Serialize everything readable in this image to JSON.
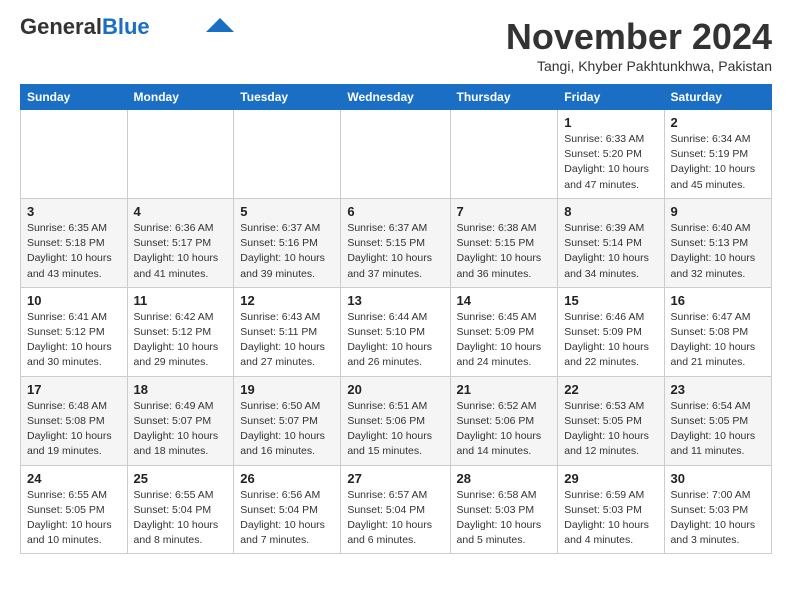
{
  "header": {
    "logo_general": "General",
    "logo_blue": "Blue",
    "month_title": "November 2024",
    "location": "Tangi, Khyber Pakhtunkhwa, Pakistan"
  },
  "days_of_week": [
    "Sunday",
    "Monday",
    "Tuesday",
    "Wednesday",
    "Thursday",
    "Friday",
    "Saturday"
  ],
  "weeks": [
    [
      {
        "day": "",
        "info": ""
      },
      {
        "day": "",
        "info": ""
      },
      {
        "day": "",
        "info": ""
      },
      {
        "day": "",
        "info": ""
      },
      {
        "day": "",
        "info": ""
      },
      {
        "day": "1",
        "info": "Sunrise: 6:33 AM\nSunset: 5:20 PM\nDaylight: 10 hours\nand 47 minutes."
      },
      {
        "day": "2",
        "info": "Sunrise: 6:34 AM\nSunset: 5:19 PM\nDaylight: 10 hours\nand 45 minutes."
      }
    ],
    [
      {
        "day": "3",
        "info": "Sunrise: 6:35 AM\nSunset: 5:18 PM\nDaylight: 10 hours\nand 43 minutes."
      },
      {
        "day": "4",
        "info": "Sunrise: 6:36 AM\nSunset: 5:17 PM\nDaylight: 10 hours\nand 41 minutes."
      },
      {
        "day": "5",
        "info": "Sunrise: 6:37 AM\nSunset: 5:16 PM\nDaylight: 10 hours\nand 39 minutes."
      },
      {
        "day": "6",
        "info": "Sunrise: 6:37 AM\nSunset: 5:15 PM\nDaylight: 10 hours\nand 37 minutes."
      },
      {
        "day": "7",
        "info": "Sunrise: 6:38 AM\nSunset: 5:15 PM\nDaylight: 10 hours\nand 36 minutes."
      },
      {
        "day": "8",
        "info": "Sunrise: 6:39 AM\nSunset: 5:14 PM\nDaylight: 10 hours\nand 34 minutes."
      },
      {
        "day": "9",
        "info": "Sunrise: 6:40 AM\nSunset: 5:13 PM\nDaylight: 10 hours\nand 32 minutes."
      }
    ],
    [
      {
        "day": "10",
        "info": "Sunrise: 6:41 AM\nSunset: 5:12 PM\nDaylight: 10 hours\nand 30 minutes."
      },
      {
        "day": "11",
        "info": "Sunrise: 6:42 AM\nSunset: 5:12 PM\nDaylight: 10 hours\nand 29 minutes."
      },
      {
        "day": "12",
        "info": "Sunrise: 6:43 AM\nSunset: 5:11 PM\nDaylight: 10 hours\nand 27 minutes."
      },
      {
        "day": "13",
        "info": "Sunrise: 6:44 AM\nSunset: 5:10 PM\nDaylight: 10 hours\nand 26 minutes."
      },
      {
        "day": "14",
        "info": "Sunrise: 6:45 AM\nSunset: 5:09 PM\nDaylight: 10 hours\nand 24 minutes."
      },
      {
        "day": "15",
        "info": "Sunrise: 6:46 AM\nSunset: 5:09 PM\nDaylight: 10 hours\nand 22 minutes."
      },
      {
        "day": "16",
        "info": "Sunrise: 6:47 AM\nSunset: 5:08 PM\nDaylight: 10 hours\nand 21 minutes."
      }
    ],
    [
      {
        "day": "17",
        "info": "Sunrise: 6:48 AM\nSunset: 5:08 PM\nDaylight: 10 hours\nand 19 minutes."
      },
      {
        "day": "18",
        "info": "Sunrise: 6:49 AM\nSunset: 5:07 PM\nDaylight: 10 hours\nand 18 minutes."
      },
      {
        "day": "19",
        "info": "Sunrise: 6:50 AM\nSunset: 5:07 PM\nDaylight: 10 hours\nand 16 minutes."
      },
      {
        "day": "20",
        "info": "Sunrise: 6:51 AM\nSunset: 5:06 PM\nDaylight: 10 hours\nand 15 minutes."
      },
      {
        "day": "21",
        "info": "Sunrise: 6:52 AM\nSunset: 5:06 PM\nDaylight: 10 hours\nand 14 minutes."
      },
      {
        "day": "22",
        "info": "Sunrise: 6:53 AM\nSunset: 5:05 PM\nDaylight: 10 hours\nand 12 minutes."
      },
      {
        "day": "23",
        "info": "Sunrise: 6:54 AM\nSunset: 5:05 PM\nDaylight: 10 hours\nand 11 minutes."
      }
    ],
    [
      {
        "day": "24",
        "info": "Sunrise: 6:55 AM\nSunset: 5:05 PM\nDaylight: 10 hours\nand 10 minutes."
      },
      {
        "day": "25",
        "info": "Sunrise: 6:55 AM\nSunset: 5:04 PM\nDaylight: 10 hours\nand 8 minutes."
      },
      {
        "day": "26",
        "info": "Sunrise: 6:56 AM\nSunset: 5:04 PM\nDaylight: 10 hours\nand 7 minutes."
      },
      {
        "day": "27",
        "info": "Sunrise: 6:57 AM\nSunset: 5:04 PM\nDaylight: 10 hours\nand 6 minutes."
      },
      {
        "day": "28",
        "info": "Sunrise: 6:58 AM\nSunset: 5:03 PM\nDaylight: 10 hours\nand 5 minutes."
      },
      {
        "day": "29",
        "info": "Sunrise: 6:59 AM\nSunset: 5:03 PM\nDaylight: 10 hours\nand 4 minutes."
      },
      {
        "day": "30",
        "info": "Sunrise: 7:00 AM\nSunset: 5:03 PM\nDaylight: 10 hours\nand 3 minutes."
      }
    ]
  ]
}
